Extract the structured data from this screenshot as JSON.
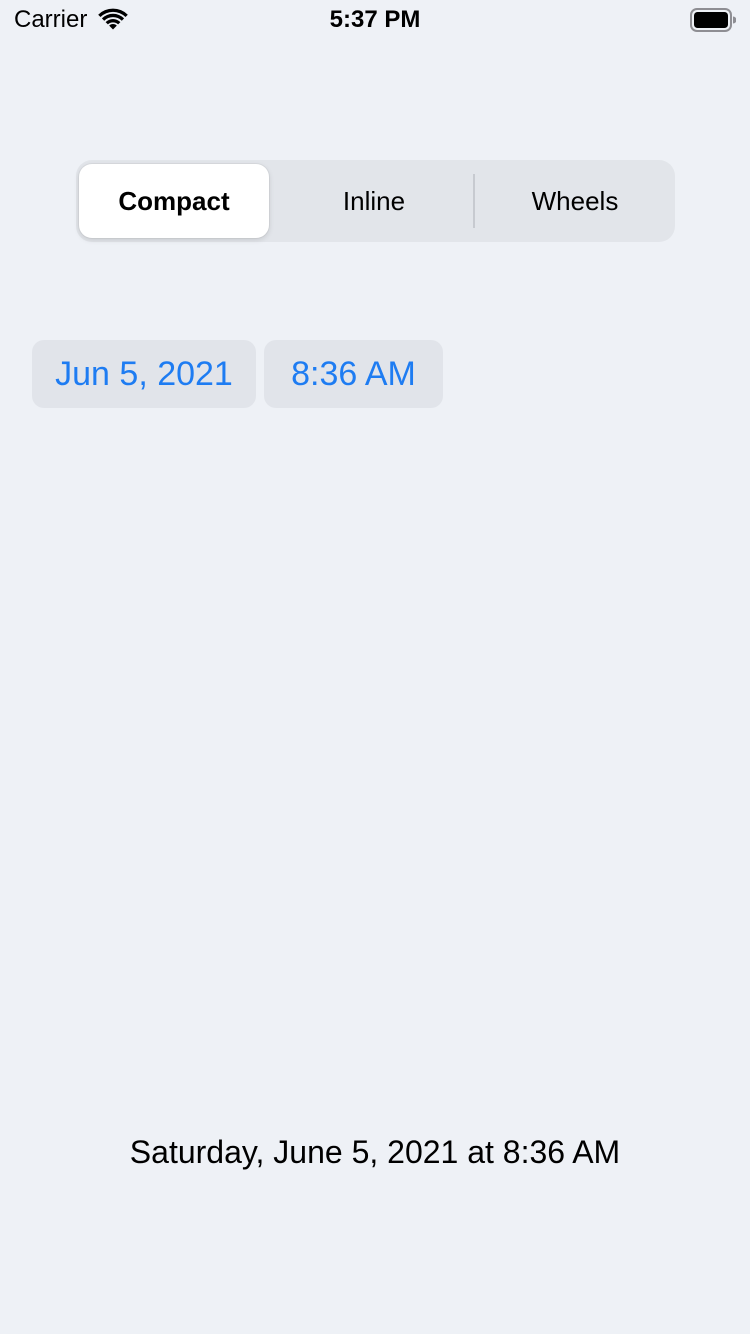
{
  "status_bar": {
    "carrier": "Carrier",
    "time": "5:37 PM",
    "icons": [
      "wifi-icon",
      "battery-icon"
    ]
  },
  "segmented_control": {
    "selected": "Compact",
    "segments": [
      {
        "label": "Compact"
      },
      {
        "label": "Inline"
      },
      {
        "label": "Wheels"
      }
    ]
  },
  "picker": {
    "date": "Jun 5, 2021",
    "time": "8:36 AM",
    "accent_color": "#1e7cf2"
  },
  "result": {
    "text": "Saturday, June 5, 2021 at 8:36 AM"
  },
  "colors": {
    "background": "#eef1f6",
    "segment_background": "#e2e5ea",
    "pill_background": "#e1e4ea"
  }
}
